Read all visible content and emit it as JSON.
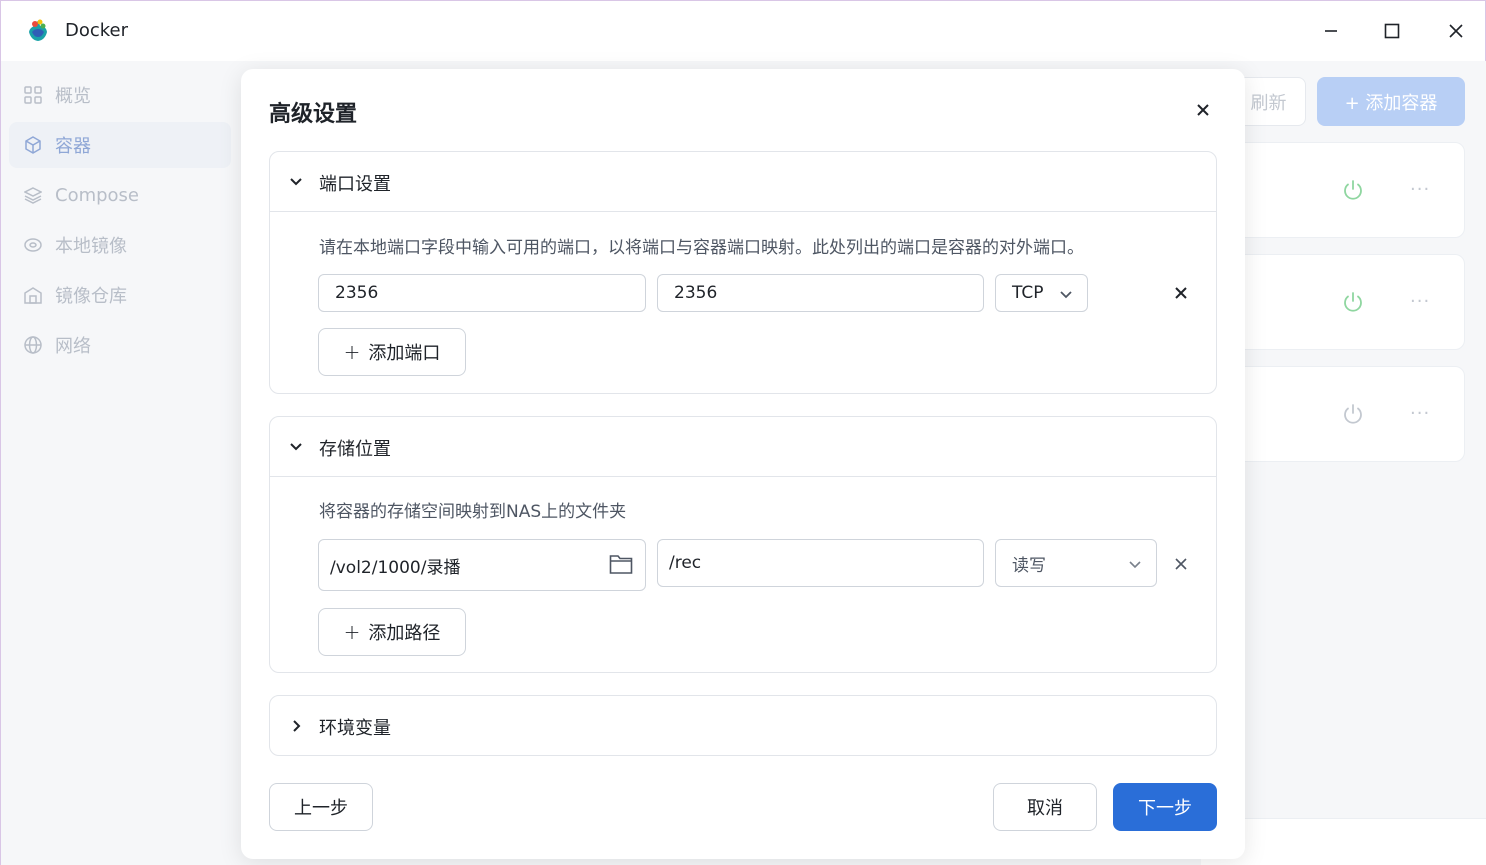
{
  "window": {
    "title": "Docker",
    "icons": [
      "docker-logo",
      "minimize-icon",
      "maximize-icon",
      "close-icon"
    ]
  },
  "sidebar": {
    "items": [
      {
        "label": "概览",
        "icon": "grid-icon",
        "active": false
      },
      {
        "label": "容器",
        "icon": "cube-icon",
        "active": true
      },
      {
        "label": "Compose",
        "icon": "layers-icon",
        "active": false
      },
      {
        "label": "本地镜像",
        "icon": "disk-icon",
        "active": false
      },
      {
        "label": "镜像仓库",
        "icon": "warehouse-icon",
        "active": false
      },
      {
        "label": "网络",
        "icon": "globe-icon",
        "active": false
      }
    ]
  },
  "background": {
    "refresh_label": "刷新",
    "add_container_label": "+ 添加容器",
    "more_label": "···"
  },
  "modal": {
    "title": "高级设置",
    "port_section": {
      "title": "端口设置",
      "expanded": true,
      "description": "请在本地端口字段中输入可用的端口，以将端口与容器端口映射。此处列出的端口是容器的对外端口。",
      "row": {
        "local_port": "2356",
        "container_port": "2356",
        "protocol": "TCP"
      },
      "add_label": "添加端口"
    },
    "storage_section": {
      "title": "存储位置",
      "expanded": true,
      "description": "将容器的存储空间映射到NAS上的文件夹",
      "row": {
        "host_path": "/vol2/1000/录播",
        "container_path": "/rec",
        "mode": "读写"
      },
      "add_label": "添加路径"
    },
    "env_section": {
      "title": "环境变量",
      "expanded": false
    },
    "buttons": {
      "prev": "上一步",
      "cancel": "取消",
      "next": "下一步"
    }
  },
  "colors": {
    "primary": "#2a6ed8",
    "border": "#cfd4db",
    "power_green": "#8fd6a0"
  }
}
